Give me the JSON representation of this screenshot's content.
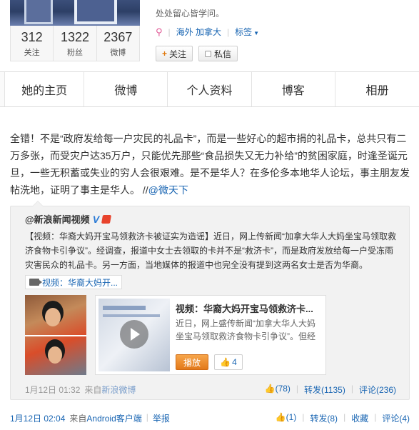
{
  "profile": {
    "bio": "处处留心皆学问。",
    "location": "海外 加拿大",
    "tags_label": "标签",
    "stats": [
      {
        "value": "312",
        "label": "关注"
      },
      {
        "value": "1322",
        "label": "粉丝"
      },
      {
        "value": "2367",
        "label": "微博"
      }
    ],
    "follow_label": "关注",
    "message_label": "私信"
  },
  "nav": {
    "tabs": [
      "她的主页",
      "微博",
      "个人资料",
      "博客",
      "相册"
    ]
  },
  "post": {
    "text": "全错！不是“政府发给每一户灾民的礼品卡”，而是一些好心的超市捐的礼品卡，总共只有二万多张，而受灾户达35万户，只能优先那些“食品损失又无力补给”的贫困家庭，时逢圣诞元旦，一些无积蓄或失业的穷人会很艰难。是不是华人？在多伦多本地华人论坛，事主朋友发帖洗地，证明了事主是华人。 //",
    "mention": "@微天下"
  },
  "repost": {
    "author": "@新浪新闻视频",
    "text": "【视频：华裔大妈开宝马领救济卡被证实为造谣】近日，网上传新闻“加拿大华人大妈坐宝马领取救济食物卡引争议”。经调查，报道中女士去领取的卡并不是“救济卡”，而是政府发放给每一户受冻雨灾害民众的礼品卡。另一方面，当地媒体的报道中也完全没有提到这两名女士是否为华裔。",
    "video_chip": "视频：华裔大妈开...",
    "video_title": "视频：华裔大妈开宝马领救济卡...",
    "video_desc": "近日，网上盛传新闻“加拿大华人大妈坐宝马领取救济食物卡引争议”。但经",
    "play_label": "播放",
    "video_likes": "4",
    "time": "1月12日 01:32",
    "source_label": "来自",
    "source": "新浪微博",
    "likes": "(78)",
    "repost_count": "转发(1135)",
    "comment_count": "评论(236)"
  },
  "footer": {
    "time": "1月12日 02:04",
    "source_label": "来自",
    "source": "Android客户端",
    "report": "举报",
    "likes": "(1)",
    "repost": "转发(8)",
    "favorite": "收藏",
    "comment": "评论(4)"
  }
}
